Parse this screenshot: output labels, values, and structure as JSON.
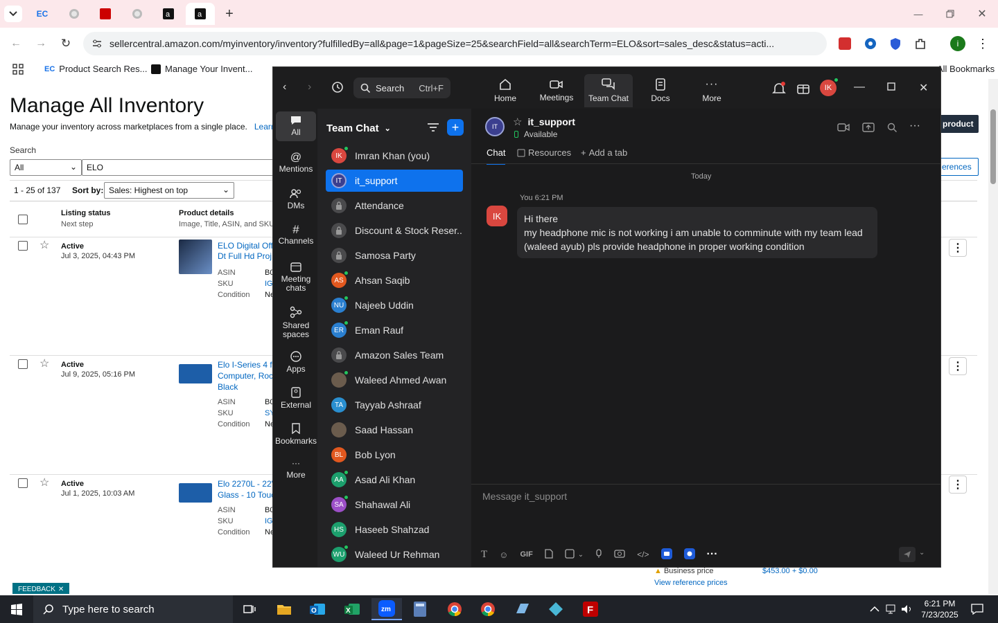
{
  "browser": {
    "url": "sellercentral.amazon.com/myinventory/inventory?fulfilledBy=all&page=1&pageSize=25&searchField=all&searchTerm=ELO&sort=sales_desc&status=acti...",
    "bookmarks": [
      "Product Search Res...",
      "Manage Your Invent...",
      "All Bookmarks"
    ],
    "tab_icons": [
      "ec-icon",
      "globe-icon",
      "dh-icon",
      "globe-icon",
      "amazon-icon",
      "amazon-icon"
    ]
  },
  "inventory": {
    "title": "Manage All Inventory",
    "subtitle": "Manage your inventory across marketplaces from a single place.",
    "learn_more": "Learn m",
    "search_label": "Search",
    "search_scope": "All",
    "search_value": "ELO",
    "results": "1 - 25 of 137",
    "sort_label": "Sort by:",
    "sort_value": "Sales: Highest on top",
    "add_product": "product",
    "preferences": "erences",
    "col_status": "Listing status",
    "col_next": "Next step",
    "col_details": "Product details",
    "col_details_sub": "Image, Title, ASIN, and SKU",
    "rows": [
      {
        "status": "Active",
        "date": "Jul 3, 2025, 04:43 PM",
        "title": "ELO Digital Offi\nDt Full Hd Proj",
        "asin": "ASIN",
        "asin_v": "B0",
        "sku": "SKU",
        "sku_v": "IG",
        "cond": "Condition",
        "cond_v": "Ne"
      },
      {
        "status": "Active",
        "date": "Jul 9, 2025, 05:16 PM",
        "title": "Elo I-Series 4 fo\nComputer, Rock\nBlack",
        "asin": "ASIN",
        "asin_v": "B0",
        "sku": "SKU",
        "sku_v": "SY",
        "cond": "Condition",
        "cond_v": "Ne"
      },
      {
        "status": "Active",
        "date": "Jul 1, 2025, 10:03 AM",
        "title": "Elo 2270L - 22\"\nGlass - 10 Touc",
        "asin": "ASIN",
        "asin_v": "B0",
        "sku": "SKU",
        "sku_v": "IG",
        "cond": "Condition",
        "cond_v": "Ne"
      }
    ],
    "business_price": "Business price",
    "business_price_val": "$453.00 + $0.00",
    "view_ref": "View reference prices",
    "feedback": "FEEDBACK"
  },
  "zoom": {
    "search": "Search",
    "search_shortcut": "Ctrl+F",
    "nav": [
      "Home",
      "Meetings",
      "Team Chat",
      "Docs",
      "More"
    ],
    "avatar": "IK",
    "sidebar": [
      "All",
      "Mentions",
      "DMs",
      "Channels",
      "Meeting\nchats",
      "Shared\nspaces",
      "Apps",
      "External",
      "Bookmarks",
      "More"
    ],
    "list_title": "Team Chat",
    "contacts": [
      {
        "initials": "IK",
        "name": "Imran Khan (you)",
        "color": "#d9473f",
        "online": true
      },
      {
        "initials": "IT",
        "name": "it_support",
        "color": "#3b3f8f",
        "online": false
      },
      {
        "initials": "",
        "name": "Attendance",
        "color": "lock",
        "online": false
      },
      {
        "initials": "",
        "name": "Discount & Stock Reser...",
        "color": "lock",
        "online": false
      },
      {
        "initials": "",
        "name": "Samosa Party",
        "color": "lock",
        "online": false
      },
      {
        "initials": "AS",
        "name": "Ahsan Saqib",
        "color": "#e2581f",
        "online": true
      },
      {
        "initials": "NU",
        "name": "Najeeb Uddin",
        "color": "#2a7fd0",
        "online": true
      },
      {
        "initials": "ER",
        "name": "Eman Rauf",
        "color": "#2a7fd0",
        "online": true
      },
      {
        "initials": "",
        "name": "Amazon Sales Team",
        "color": "lock",
        "online": false
      },
      {
        "initials": "",
        "name": "Waleed Ahmed Awan",
        "color": "#6b5c4d",
        "online": true
      },
      {
        "initials": "TA",
        "name": "Tayyab Ashraaf",
        "color": "#2a8fd0",
        "online": false
      },
      {
        "initials": "",
        "name": "Saad Hassan",
        "color": "#6b5c4d",
        "online": false
      },
      {
        "initials": "BL",
        "name": "Bob Lyon",
        "color": "#e2581f",
        "online": false
      },
      {
        "initials": "AA",
        "name": "Asad Ali Khan",
        "color": "#1c9f6d",
        "online": true
      },
      {
        "initials": "SA",
        "name": "Shahawal Ali",
        "color": "#9c4fc7",
        "online": true
      },
      {
        "initials": "HS",
        "name": "Haseeb Shahzad",
        "color": "#1c9f6d",
        "online": false
      },
      {
        "initials": "WU",
        "name": "Waleed Ur Rehman",
        "color": "#1c9f6d",
        "online": true
      }
    ],
    "chat_name": "it_support",
    "chat_status": "Available",
    "tabs": [
      "Chat",
      "Resources",
      "Add a tab"
    ],
    "day": "Today",
    "sender": "You 6:21 PM",
    "sender_avatar": "IK",
    "message_l1": "Hi there",
    "message_l2": "my headphone mic is not working i am unable to comminute with my team lead (waleed ayub) pls provide headphone in proper working condition",
    "composer_placeholder": "Message it_support",
    "gif": "GIF"
  },
  "taskbar": {
    "search": "Type here to search",
    "time": "6:21 PM",
    "date": "7/23/2025"
  }
}
